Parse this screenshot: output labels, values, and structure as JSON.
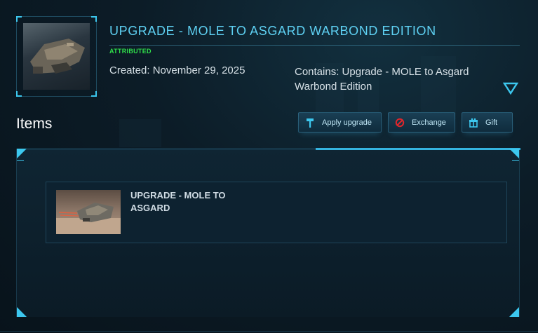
{
  "pledge": {
    "title": "UPGRADE - MOLE TO ASGARD WARBOND EDITION",
    "badge": "ATTRIBUTED",
    "created": "Created: November 29, 2025",
    "contains": "Contains: Upgrade - MOLE to Asgard Warbond Edition",
    "thumbnail_icon": "ship-thumbnail",
    "expand_icon": "chevron-down-icon"
  },
  "items_section": {
    "heading": "Items"
  },
  "actions": {
    "apply_label": "Apply upgrade",
    "exchange_label": "Exchange",
    "gift_label": "Gift"
  },
  "items": [
    {
      "name": "UPGRADE - MOLE TO ASGARD",
      "image": "ship-upgrade-image"
    }
  ],
  "colors": {
    "accent": "#3cc7ee",
    "title": "#5ed0f2",
    "badge": "#2fe04a",
    "exchange_icon": "#e0262b"
  }
}
